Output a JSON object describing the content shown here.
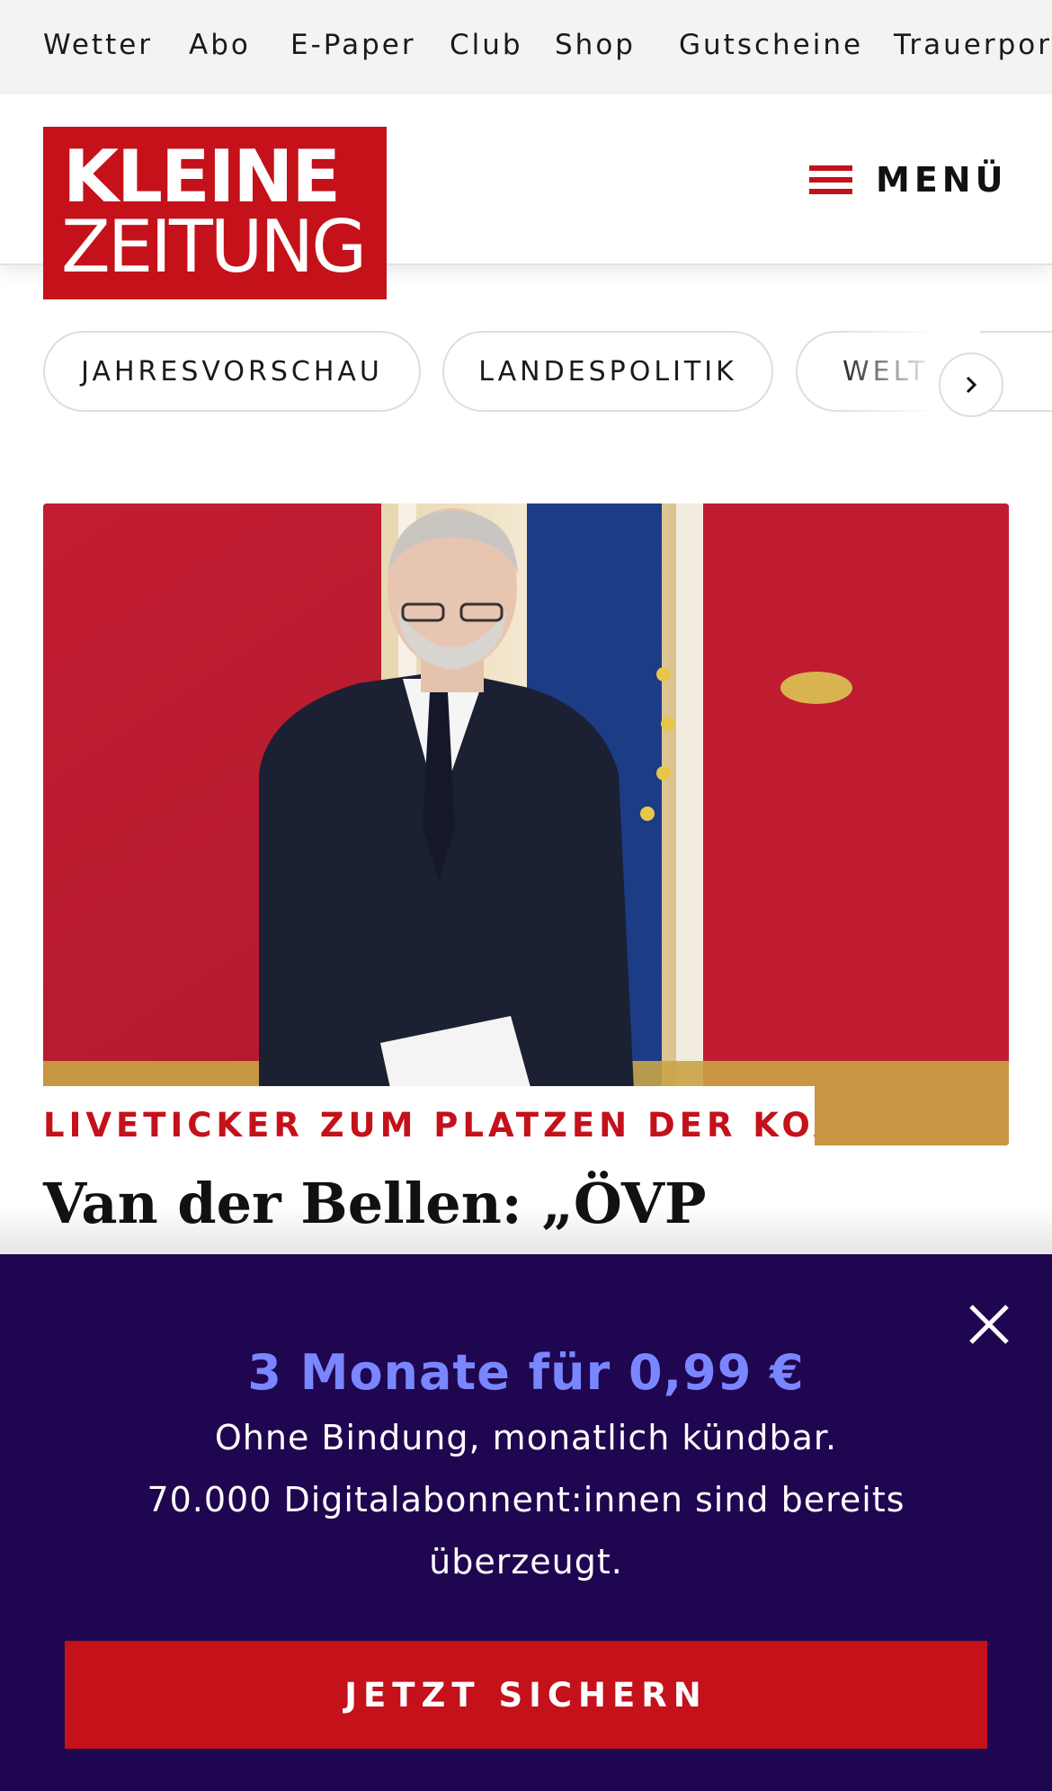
{
  "topnav": {
    "items": [
      "Wetter",
      "Abo",
      "E-Paper",
      "Club",
      "Shop",
      "Gutscheine",
      "Trauerportal"
    ]
  },
  "header": {
    "logo_line1": "KLEINE",
    "logo_line2": "ZEITUNG",
    "menu_label": "MENÜ",
    "brand_color": "#c4111a"
  },
  "topics": {
    "chips": [
      "JAHRESVORSCHAU",
      "LANDESPOLITIK",
      "WELT"
    ],
    "next_icon": "chevron-right-icon"
  },
  "article": {
    "kicker": "LIVETICKER ZUM PLATZEN DER KOA…",
    "headline": "Van der Bellen: „ÖVP"
  },
  "paywall": {
    "title": "3 Monate für 0,99 €",
    "line1": "Ohne Bindung, monatlich kündbar.",
    "line2": "70.000 Digitalabonnent:innen sind bereits",
    "line3": "überzeugt.",
    "cta_label": "JETZT SICHERN",
    "background_color": "#1f0650",
    "accent_color": "#7a86ff"
  }
}
